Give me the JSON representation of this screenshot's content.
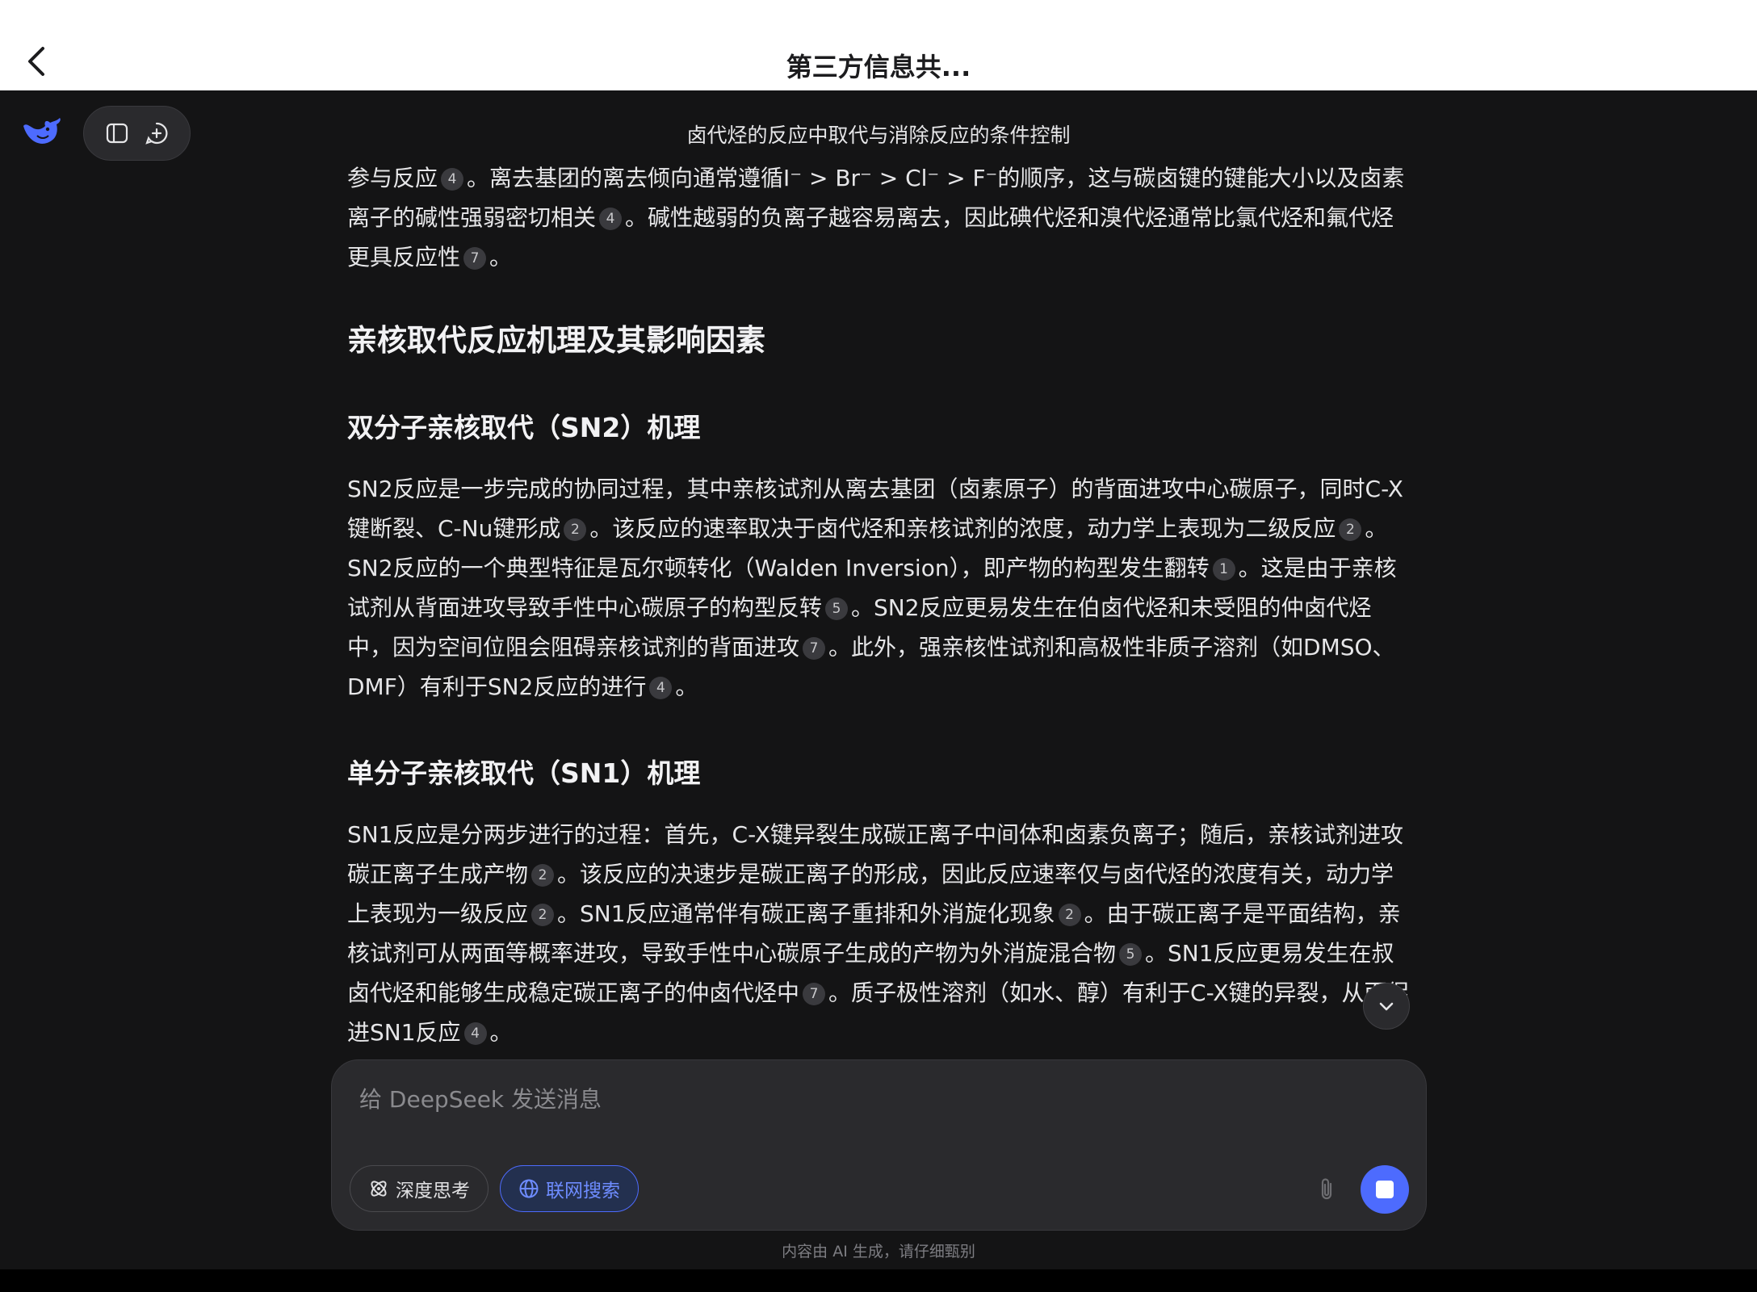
{
  "topbar": {
    "title": "第三方信息共..."
  },
  "header": {
    "chat_title": "卤代烃的反应中取代与消除反应的条件控制"
  },
  "content": {
    "intro_line1": "参与反应",
    "intro_cite1": "4",
    "intro_line1b": "。离去基团的离去倾向通常遵循I⁻ > Br⁻ > Cl⁻ > F⁻的顺序，这与碳卤键的键能大小以及卤素离子",
    "intro_line2": "的碱性强弱密切相关",
    "intro_cite2": "4",
    "intro_line2b": "。碱性越弱的负离子越容易离去，因此碘代烃和溴代烃通常比氯代烃和氟代烃更具反应性",
    "intro_cite3": "7",
    "intro_end": "。",
    "h_main": "亲核取代反应机理及其影响因素",
    "h_sn2": "双分子亲核取代（SN2）机理",
    "sn2": {
      "t1": "SN2反应是一步完成的协同过程，其中亲核试剂从离去基团（卤素原子）的背面进攻中心碳原子，同时C-X键断裂、C-Nu键形成",
      "c1": "2",
      "t2": "。该反应的速率取决于卤代烃和亲核试剂的浓度，动力学上表现为二级反应",
      "c2": "2",
      "t3": "。SN2反应的一个典型特征是瓦尔顿转化（Walden Inversion），即产物的构型发生翻转",
      "c3": "1",
      "t4": "。这是由于亲核试剂从背面进攻导致手性中心碳原子的构型反转",
      "c4": "5",
      "t5": "。SN2反应更易发生在伯卤代烃和未受阻的仲卤代烃中，因为空间位阻会阻碍亲核试剂的背面进攻",
      "c5": "7",
      "t6": "。此外，强亲核性试剂和高极性非质子溶剂（如DMSO、DMF）有利于SN2反应的进行",
      "c6": "4",
      "t7": "。"
    },
    "h_sn1": "单分子亲核取代（SN1）机理",
    "sn1": {
      "t1": "SN1反应是分两步进行的过程：首先，C-X键异裂生成碳正离子中间体和卤素负离子；随后，亲核试剂进攻碳正离子生成产物",
      "c1": "2",
      "t2": "。该反应的决速步是碳正离子的形成，因此反应速率仅与卤代烃的浓度有关，动力学上表现为一级反应",
      "c2": "2",
      "t3": "。SN1反应通常伴有碳正离子重排和外消旋化现象",
      "c3": "2",
      "t4": "。由于碳正离子是平面结构，亲核试剂可从两面等概率进攻，导致手性中心碳原子生成的产物为外消旋混合物",
      "c4": "5",
      "t5": "。SN1反应更易发生在叔卤代烃和能够生成稳定碳正离子的仲卤代烃中",
      "c5": "7",
      "t6": "。质子极性溶剂（如水、醇）有利于C-X键的异裂，从而促进SN1反应",
      "c6": "4",
      "t7": "。"
    }
  },
  "composer": {
    "placeholder": "给 DeepSeek 发送消息",
    "deep_think_label": "深度思考",
    "web_search_label": "联网搜索"
  },
  "footer": {
    "note": "内容由 AI 生成，请仔细甄别"
  },
  "colors": {
    "accent": "#4d6bfe",
    "background": "#141415",
    "surface": "#2a2a2d"
  }
}
